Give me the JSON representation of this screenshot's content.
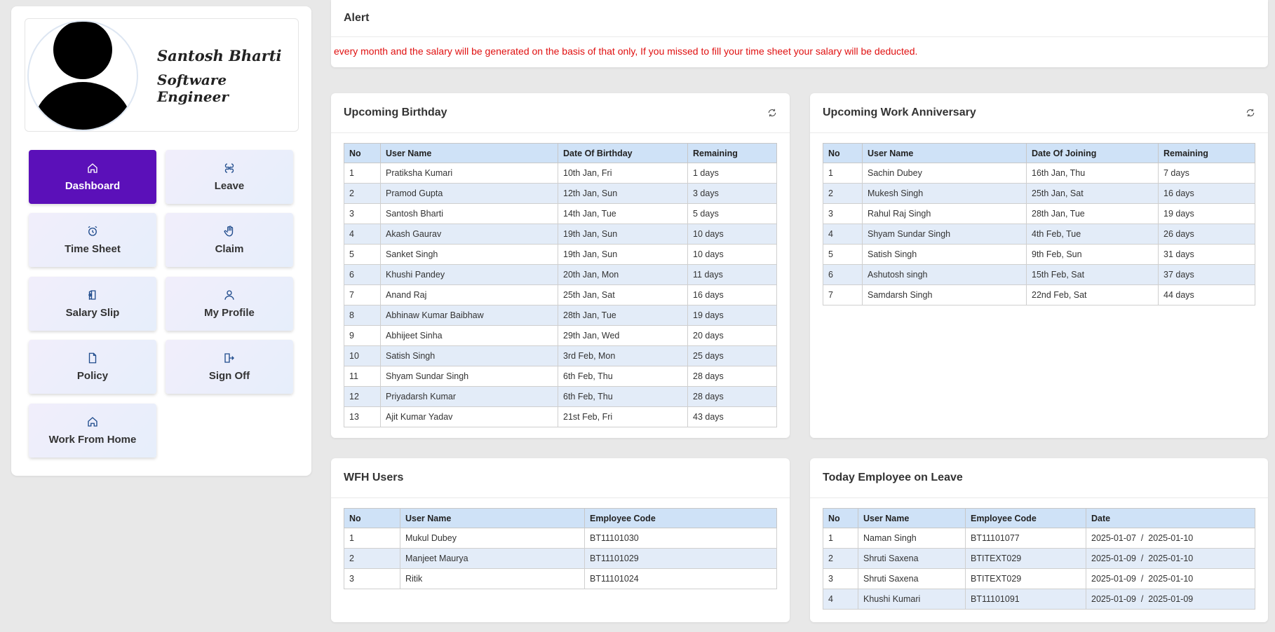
{
  "profile": {
    "name": "Santosh Bharti",
    "role": "Software Engineer"
  },
  "nav": [
    {
      "label": "Dashboard",
      "icon": "home-icon",
      "active": true
    },
    {
      "label": "Leave",
      "icon": "leave-icon",
      "active": false
    },
    {
      "label": "Time Sheet",
      "icon": "alarm-clock-icon",
      "active": false
    },
    {
      "label": "Claim",
      "icon": "hand-icon",
      "active": false
    },
    {
      "label": "Salary Slip",
      "icon": "salary-slip-icon",
      "active": false
    },
    {
      "label": "My Profile",
      "icon": "user-icon",
      "active": false
    },
    {
      "label": "Policy",
      "icon": "document-icon",
      "active": false
    },
    {
      "label": "Sign Off",
      "icon": "sign-off-icon",
      "active": false
    },
    {
      "label": "Work From Home",
      "icon": "home-icon",
      "active": false
    }
  ],
  "colors": {
    "active_nav": "#5b10b9",
    "alert_text": "#e01010",
    "table_header": "#cfe2f7",
    "table_stripe": "#e3ecf8"
  },
  "alert": {
    "title": "Alert",
    "message": "every month and the salary will be generated on the basis of that only, If you missed to fill your time sheet your salary will be deducted."
  },
  "birthday": {
    "title": "Upcoming Birthday",
    "columns": [
      "No",
      "User Name",
      "Date Of Birthday",
      "Remaining"
    ],
    "rows": [
      [
        "1",
        "Pratiksha Kumari",
        "10th Jan, Fri",
        "1 days"
      ],
      [
        "2",
        "Pramod Gupta",
        "12th Jan, Sun",
        "3 days"
      ],
      [
        "3",
        "Santosh Bharti",
        "14th Jan, Tue",
        "5 days"
      ],
      [
        "4",
        "Akash Gaurav",
        "19th Jan, Sun",
        "10 days"
      ],
      [
        "5",
        "Sanket Singh",
        "19th Jan, Sun",
        "10 days"
      ],
      [
        "6",
        "Khushi Pandey",
        "20th Jan, Mon",
        "11 days"
      ],
      [
        "7",
        "Anand Raj",
        "25th Jan, Sat",
        "16 days"
      ],
      [
        "8",
        "Abhinaw Kumar Baibhaw",
        "28th Jan, Tue",
        "19 days"
      ],
      [
        "9",
        "Abhijeet Sinha",
        "29th Jan, Wed",
        "20 days"
      ],
      [
        "10",
        "Satish Singh",
        "3rd Feb, Mon",
        "25 days"
      ],
      [
        "11",
        "Shyam Sundar Singh",
        "6th Feb, Thu",
        "28 days"
      ],
      [
        "12",
        "Priyadarsh Kumar",
        "6th Feb, Thu",
        "28 days"
      ],
      [
        "13",
        "Ajit Kumar Yadav",
        "21st Feb, Fri",
        "43 days"
      ]
    ]
  },
  "anniversary": {
    "title": "Upcoming Work Anniversary",
    "columns": [
      "No",
      "User Name",
      "Date Of Joining",
      "Remaining"
    ],
    "rows": [
      [
        "1",
        "Sachin Dubey",
        "16th Jan, Thu",
        "7 days"
      ],
      [
        "2",
        "Mukesh Singh",
        "25th Jan, Sat",
        "16 days"
      ],
      [
        "3",
        "Rahul Raj Singh",
        "28th Jan, Tue",
        "19 days"
      ],
      [
        "4",
        "Shyam Sundar Singh",
        "4th Feb, Tue",
        "26 days"
      ],
      [
        "5",
        "Satish Singh",
        "9th Feb, Sun",
        "31 days"
      ],
      [
        "6",
        "Ashutosh singh",
        "15th Feb, Sat",
        "37 days"
      ],
      [
        "7",
        "Samdarsh Singh",
        "22nd Feb, Sat",
        "44 days"
      ]
    ]
  },
  "wfh": {
    "title": "WFH Users",
    "columns": [
      "No",
      "User Name",
      "Employee Code"
    ],
    "rows": [
      [
        "1",
        "Mukul Dubey",
        "BT11101030"
      ],
      [
        "2",
        "Manjeet Maurya",
        "BT11101029"
      ],
      [
        "3",
        "Ritik",
        "BT11101024"
      ]
    ]
  },
  "leave": {
    "title": "Today Employee on Leave",
    "columns": [
      "No",
      "User Name",
      "Employee Code",
      "Date"
    ],
    "rows": [
      [
        "1",
        "Naman Singh",
        "BT11101077",
        "2025-01-07  /  2025-01-10"
      ],
      [
        "2",
        "Shruti Saxena",
        "BTITEXT029",
        "2025-01-09  /  2025-01-10"
      ],
      [
        "3",
        "Shruti Saxena",
        "BTITEXT029",
        "2025-01-09  /  2025-01-10"
      ],
      [
        "4",
        "Khushi Kumari",
        "BT11101091",
        "2025-01-09  /  2025-01-09"
      ]
    ]
  }
}
